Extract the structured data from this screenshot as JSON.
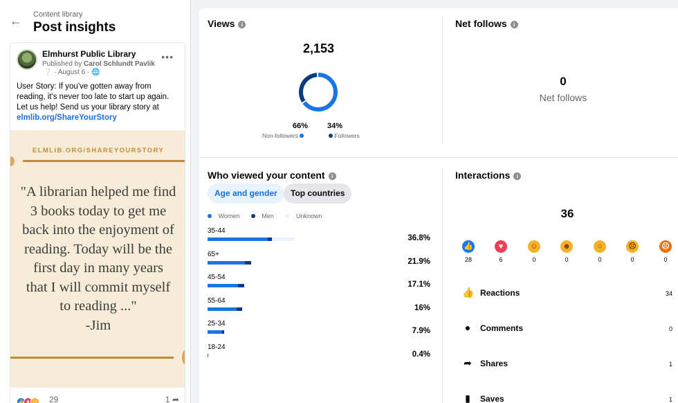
{
  "header": {
    "breadcrumb": "Content library",
    "title": "Post insights",
    "back_icon": "arrow-left-icon"
  },
  "post": {
    "page_name": "Elmhurst Public Library",
    "published_by_prefix": "Published by ",
    "published_by_name": "Carol Schlundt Pavlik",
    "date": "· August 6 ·",
    "more_label": "•••",
    "text": "User Story: If you've gotten away from reading, it's never too late to start up again. Let us help! Send us your library story at",
    "link": "elmlib.org/ShareYourStory",
    "image": {
      "url_text": "ELMLIB.ORG/SHAREYOURSTORY",
      "quote_lines": [
        "\"A librarian helped me find",
        "3 books today to get me",
        "back into the enjoyment of",
        "reading. Today will be the",
        "first day in many years",
        "that I will commit myself",
        "to reading ...\"",
        "-Jim"
      ]
    },
    "reaction_count": "29",
    "share_count": "1"
  },
  "views": {
    "title": "Views",
    "total": "2,153",
    "non_followers_pct": "66%",
    "non_followers_label": "Non-followers",
    "followers_pct": "34%",
    "followers_label": "Followers",
    "non_followers_share": 0.66,
    "followers_share": 0.34,
    "non_followers_color": "#1b74e4",
    "followers_color": "#0c3b82"
  },
  "net_follows": {
    "title": "Net follows",
    "value": "0",
    "label": "Net follows"
  },
  "who_viewed": {
    "title": "Who viewed your content",
    "tabs": [
      "Age and gender",
      "Top countries"
    ],
    "legend": [
      "Women",
      "Men",
      "Unknown"
    ],
    "colors": {
      "women": "#1b74e4",
      "men": "#0c3b82",
      "unknown": "#e7f3ff"
    },
    "age_groups": [
      {
        "label": "35-44",
        "pct": "36.8%",
        "share": 0.368,
        "women": 0.29,
        "men": 0.02,
        "unknown": 0.11
      },
      {
        "label": "65+",
        "pct": "21.9%",
        "share": 0.219,
        "women": 0.18,
        "men": 0.03,
        "unknown": 0
      },
      {
        "label": "45-54",
        "pct": "17.1%",
        "share": 0.171,
        "women": 0.145,
        "men": 0.03,
        "unknown": 0
      },
      {
        "label": "55-64",
        "pct": "16%",
        "share": 0.16,
        "women": 0.14,
        "men": 0.025,
        "unknown": 0
      },
      {
        "label": "25-34",
        "pct": "7.9%",
        "share": 0.079,
        "women": 0.07,
        "men": 0.01,
        "unknown": 0
      },
      {
        "label": "18-24",
        "pct": "0.4%",
        "share": 0.004,
        "women": 0.004,
        "men": 0,
        "unknown": 0
      }
    ]
  },
  "interactions": {
    "title": "Interactions",
    "total": "36",
    "reactions": [
      {
        "name": "like-icon",
        "count": "0",
        "display": "28"
      },
      {
        "name": "love-icon",
        "count": "6"
      },
      {
        "name": "care-icon",
        "count": "0"
      },
      {
        "name": "haha-icon",
        "count": "0"
      },
      {
        "name": "wow-icon",
        "count": "0"
      },
      {
        "name": "sad-icon",
        "count": "0"
      },
      {
        "name": "angry-icon",
        "count": "0"
      }
    ],
    "rows": [
      {
        "label": "Reactions",
        "value": "34",
        "icon": "thumbs-up-icon"
      },
      {
        "label": "Comments",
        "value": "0",
        "icon": "comment-icon"
      },
      {
        "label": "Shares",
        "value": "1",
        "icon": "share-icon"
      },
      {
        "label": "Saves",
        "value": "1",
        "icon": "bookmark-icon"
      }
    ]
  }
}
